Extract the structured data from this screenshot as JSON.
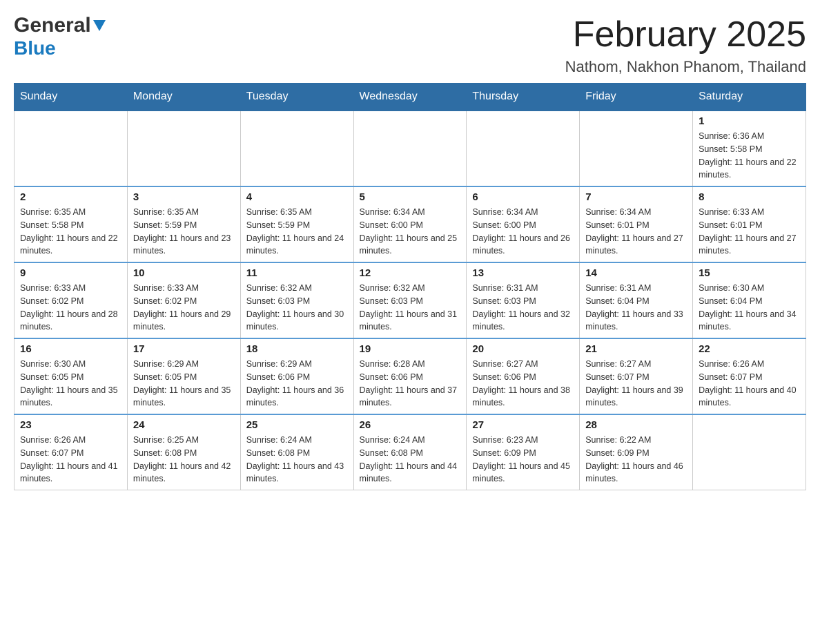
{
  "header": {
    "logo_general": "General",
    "logo_blue": "Blue",
    "month_title": "February 2025",
    "location": "Nathom, Nakhon Phanom, Thailand"
  },
  "days_of_week": [
    "Sunday",
    "Monday",
    "Tuesday",
    "Wednesday",
    "Thursday",
    "Friday",
    "Saturday"
  ],
  "weeks": [
    {
      "days": [
        {
          "num": "",
          "info": ""
        },
        {
          "num": "",
          "info": ""
        },
        {
          "num": "",
          "info": ""
        },
        {
          "num": "",
          "info": ""
        },
        {
          "num": "",
          "info": ""
        },
        {
          "num": "",
          "info": ""
        },
        {
          "num": "1",
          "info": "Sunrise: 6:36 AM\nSunset: 5:58 PM\nDaylight: 11 hours and 22 minutes."
        }
      ]
    },
    {
      "days": [
        {
          "num": "2",
          "info": "Sunrise: 6:35 AM\nSunset: 5:58 PM\nDaylight: 11 hours and 22 minutes."
        },
        {
          "num": "3",
          "info": "Sunrise: 6:35 AM\nSunset: 5:59 PM\nDaylight: 11 hours and 23 minutes."
        },
        {
          "num": "4",
          "info": "Sunrise: 6:35 AM\nSunset: 5:59 PM\nDaylight: 11 hours and 24 minutes."
        },
        {
          "num": "5",
          "info": "Sunrise: 6:34 AM\nSunset: 6:00 PM\nDaylight: 11 hours and 25 minutes."
        },
        {
          "num": "6",
          "info": "Sunrise: 6:34 AM\nSunset: 6:00 PM\nDaylight: 11 hours and 26 minutes."
        },
        {
          "num": "7",
          "info": "Sunrise: 6:34 AM\nSunset: 6:01 PM\nDaylight: 11 hours and 27 minutes."
        },
        {
          "num": "8",
          "info": "Sunrise: 6:33 AM\nSunset: 6:01 PM\nDaylight: 11 hours and 27 minutes."
        }
      ]
    },
    {
      "days": [
        {
          "num": "9",
          "info": "Sunrise: 6:33 AM\nSunset: 6:02 PM\nDaylight: 11 hours and 28 minutes."
        },
        {
          "num": "10",
          "info": "Sunrise: 6:33 AM\nSunset: 6:02 PM\nDaylight: 11 hours and 29 minutes."
        },
        {
          "num": "11",
          "info": "Sunrise: 6:32 AM\nSunset: 6:03 PM\nDaylight: 11 hours and 30 minutes."
        },
        {
          "num": "12",
          "info": "Sunrise: 6:32 AM\nSunset: 6:03 PM\nDaylight: 11 hours and 31 minutes."
        },
        {
          "num": "13",
          "info": "Sunrise: 6:31 AM\nSunset: 6:03 PM\nDaylight: 11 hours and 32 minutes."
        },
        {
          "num": "14",
          "info": "Sunrise: 6:31 AM\nSunset: 6:04 PM\nDaylight: 11 hours and 33 minutes."
        },
        {
          "num": "15",
          "info": "Sunrise: 6:30 AM\nSunset: 6:04 PM\nDaylight: 11 hours and 34 minutes."
        }
      ]
    },
    {
      "days": [
        {
          "num": "16",
          "info": "Sunrise: 6:30 AM\nSunset: 6:05 PM\nDaylight: 11 hours and 35 minutes."
        },
        {
          "num": "17",
          "info": "Sunrise: 6:29 AM\nSunset: 6:05 PM\nDaylight: 11 hours and 35 minutes."
        },
        {
          "num": "18",
          "info": "Sunrise: 6:29 AM\nSunset: 6:06 PM\nDaylight: 11 hours and 36 minutes."
        },
        {
          "num": "19",
          "info": "Sunrise: 6:28 AM\nSunset: 6:06 PM\nDaylight: 11 hours and 37 minutes."
        },
        {
          "num": "20",
          "info": "Sunrise: 6:27 AM\nSunset: 6:06 PM\nDaylight: 11 hours and 38 minutes."
        },
        {
          "num": "21",
          "info": "Sunrise: 6:27 AM\nSunset: 6:07 PM\nDaylight: 11 hours and 39 minutes."
        },
        {
          "num": "22",
          "info": "Sunrise: 6:26 AM\nSunset: 6:07 PM\nDaylight: 11 hours and 40 minutes."
        }
      ]
    },
    {
      "days": [
        {
          "num": "23",
          "info": "Sunrise: 6:26 AM\nSunset: 6:07 PM\nDaylight: 11 hours and 41 minutes."
        },
        {
          "num": "24",
          "info": "Sunrise: 6:25 AM\nSunset: 6:08 PM\nDaylight: 11 hours and 42 minutes."
        },
        {
          "num": "25",
          "info": "Sunrise: 6:24 AM\nSunset: 6:08 PM\nDaylight: 11 hours and 43 minutes."
        },
        {
          "num": "26",
          "info": "Sunrise: 6:24 AM\nSunset: 6:08 PM\nDaylight: 11 hours and 44 minutes."
        },
        {
          "num": "27",
          "info": "Sunrise: 6:23 AM\nSunset: 6:09 PM\nDaylight: 11 hours and 45 minutes."
        },
        {
          "num": "28",
          "info": "Sunrise: 6:22 AM\nSunset: 6:09 PM\nDaylight: 11 hours and 46 minutes."
        },
        {
          "num": "",
          "info": ""
        }
      ]
    }
  ]
}
